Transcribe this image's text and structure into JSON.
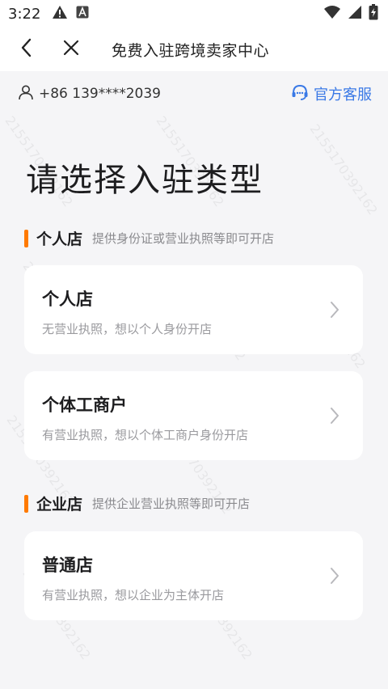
{
  "status_bar": {
    "time": "3:22",
    "icons_left": [
      "warning-icon",
      "text-a-icon"
    ],
    "icons_right": [
      "wifi-icon",
      "signal-icon",
      "battery-charging-icon"
    ]
  },
  "nav": {
    "title": "免费入驻跨境卖家中心",
    "back_icon": "chevron-left-icon",
    "close_icon": "close-icon"
  },
  "user": {
    "phone": "+86 139****2039",
    "service_label": "官方客服",
    "accent_color": "#3a79e6"
  },
  "page_title": "请选择入驻类型",
  "sections": [
    {
      "name": "个人店",
      "desc": "提供身份证或营业执照等即可开店",
      "cards": [
        {
          "title": "个人店",
          "desc": "无营业执照，想以个人身份开店"
        },
        {
          "title": "个体工商户",
          "desc": "有营业执照，想以个体工商户身份开店"
        }
      ]
    },
    {
      "name": "企业店",
      "desc": "提供企业营业执照等即可开店",
      "cards": [
        {
          "title": "普通店",
          "desc": "有营业执照，想以企业为主体开店"
        }
      ]
    }
  ],
  "watermark_text": "2155170392162",
  "section_bar_color": "#ff7a00"
}
